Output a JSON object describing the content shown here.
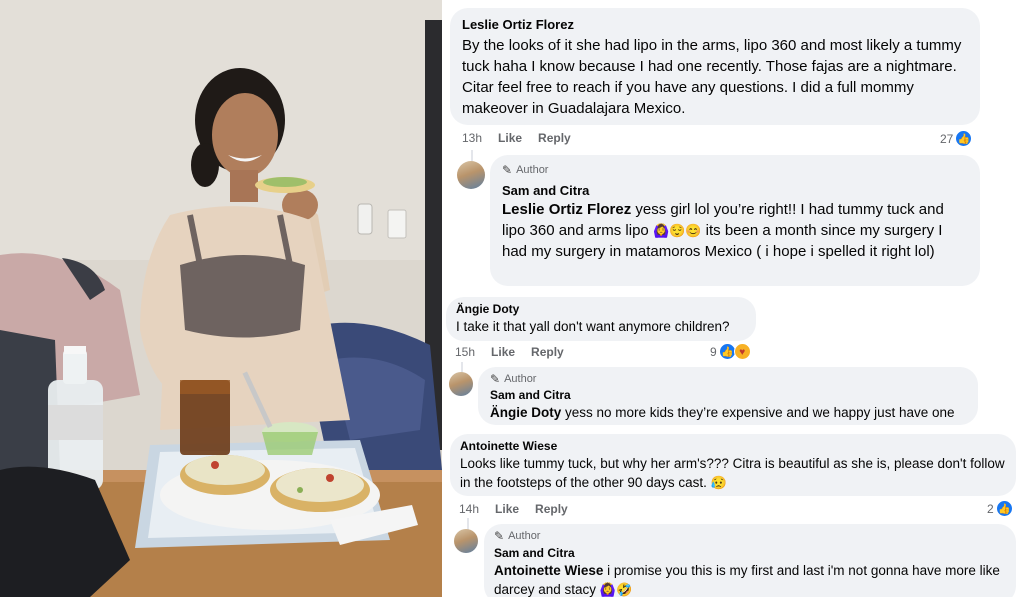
{
  "colors": {
    "bubble_bg": "#f0f2f5",
    "meta_text": "#65676b",
    "like_blue": "#1877f2"
  },
  "photo": {
    "scene_icon": "woman-eating-tostada-photo"
  },
  "comments": [
    {
      "name": "Leslie Ortiz Florez",
      "text": "By the looks of it she had lipo in the arms, lipo 360 and most likely a tummy tuck haha I know because I had one recently. Those fajas are a nightmare. Citar feel free to reach if you have any questions. I did a full mommy makeover in Guadalajara Mexico.",
      "time": "13h",
      "like_label": "Like",
      "reply_label": "Reply",
      "reaction_count": "27",
      "reply": {
        "badge": "Author",
        "name": "Sam and Citra",
        "mention": "Leslie Ortiz Florez",
        "text_a": " yess girl lol you’re right!! I had tummy tuck and lipo 360 and arms lipo ",
        "emojis_a": "🙆‍♀️😌😊",
        "text_b": " its been a month since my surgery I had my surgery in matamoros Mexico ( i hope i spelled it right lol)"
      }
    },
    {
      "name": "Ängie Doty",
      "text": "I take it that yall don't want anymore children?",
      "time": "15h",
      "like_label": "Like",
      "reply_label": "Reply",
      "reaction_count": "9",
      "reply": {
        "badge": "Author",
        "name": "Sam and Citra",
        "mention": "Ängie Doty",
        "text": " yess no more kids they’re expensive and we happy just have one"
      }
    },
    {
      "name": "Antoinette Wiese",
      "text": "Looks like tummy tuck, but why her arm's??? Citra is beautiful as she is, please don't follow in the footsteps of the other 90 days cast. ",
      "emoji": "😥",
      "time": "14h",
      "like_label": "Like",
      "reply_label": "Reply",
      "reaction_count": "2",
      "reply": {
        "badge": "Author",
        "name": "Sam and Citra",
        "mention": "Antoinette Wiese",
        "text": " i promise you this is my first and last i'm not gonna have more like darcey and stacy ",
        "emojis": "🙆‍♀️🤣"
      }
    }
  ]
}
